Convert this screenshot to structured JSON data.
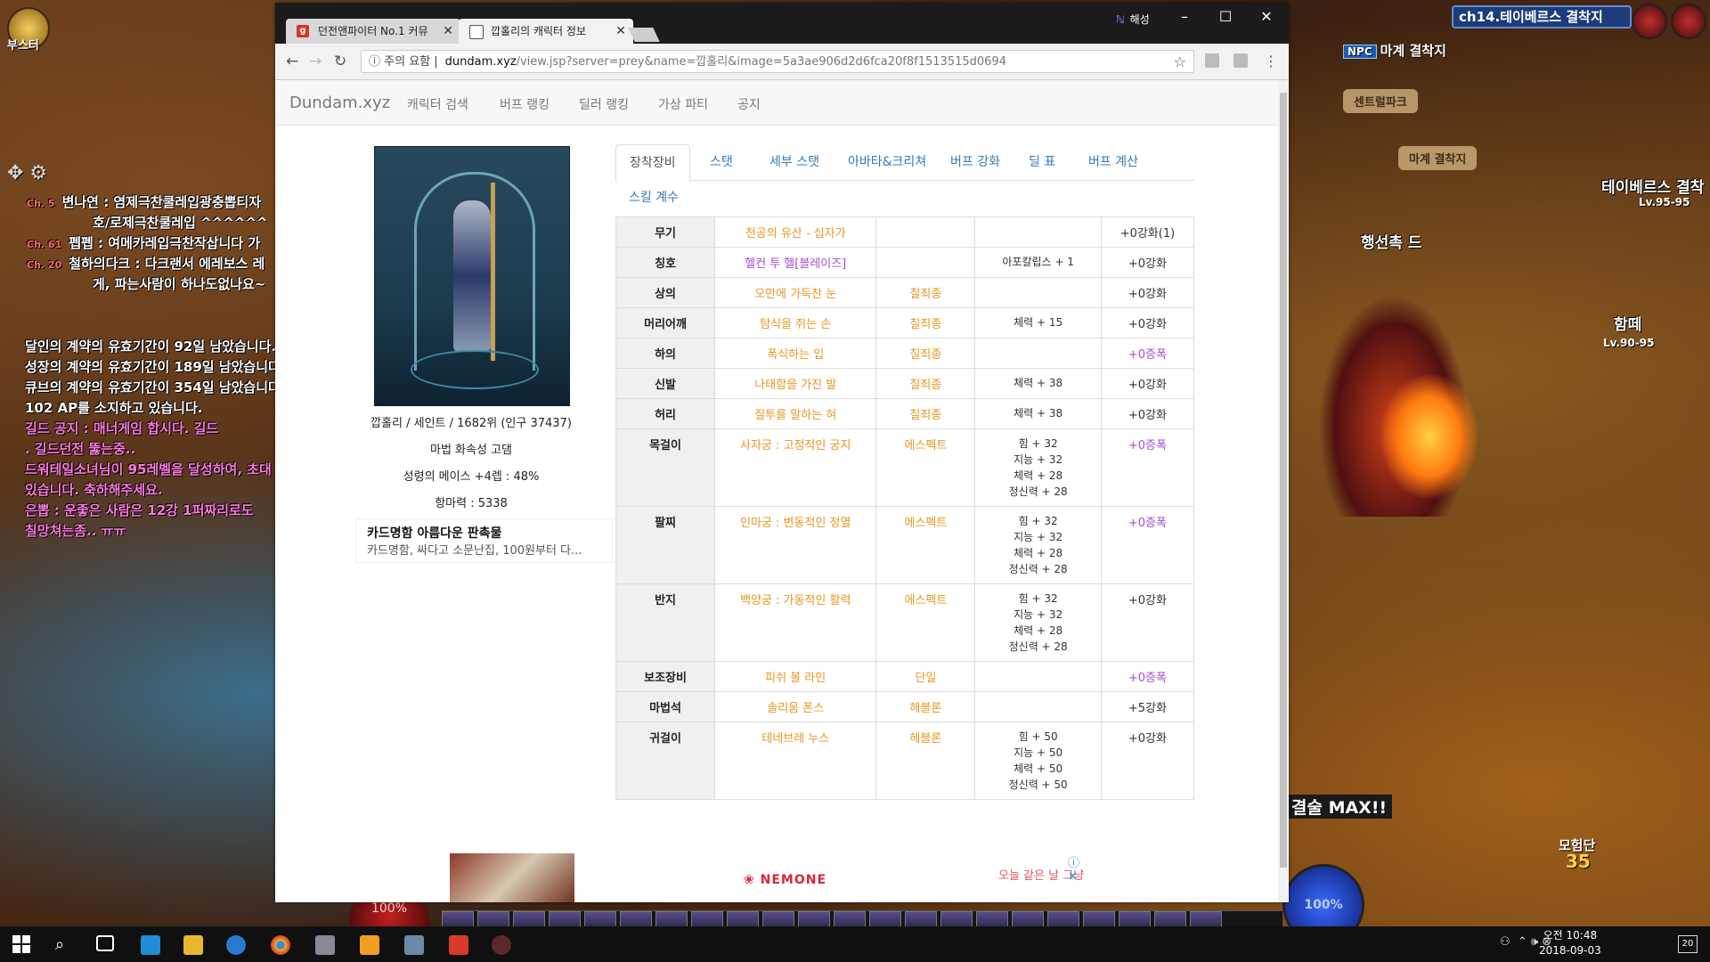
{
  "game": {
    "booster_label": "부스터",
    "chat": [
      {
        "channel": "Ch. 5",
        "text": "변나연 : 염제극찬쿨레입광충뽑티자",
        "color": "white"
      },
      {
        "channel": "",
        "text": "호/로제극찬쿨레입 ^^^^^^",
        "color": "white"
      },
      {
        "channel": "Ch. 61",
        "text": "펩펩 : 여메카레입극찬작삽니다 가",
        "color": "white"
      },
      {
        "channel": "Ch. 20",
        "text": "철하의다크 : 다크랜서 에레보스 레",
        "color": "white"
      },
      {
        "channel": "",
        "text": "게, 파는사람이 하나도없나요~",
        "color": "white"
      }
    ],
    "notices": [
      {
        "text": "달인의 계약의 유효기간이 92일 남았습니다.",
        "color": "white"
      },
      {
        "text": "성장의 계약의 유효기간이 189일 남았습니다.",
        "color": "white"
      },
      {
        "text": "큐브의 계약의 유효기간이 354일 남았습니다.",
        "color": "white"
      },
      {
        "text": "102 AP를 소지하고 있습니다.",
        "color": "white"
      },
      {
        "text": "길드 공지 : 매너게임 합시다. 길드",
        "color": "pink"
      },
      {
        "text": ". 길드던전 뚫는중..",
        "color": "pink"
      },
      {
        "text": "드워테일소녀님이 95레벨을 달성하여, 초대",
        "color": "pink"
      },
      {
        "text": "있습니다. 축하해주세요.",
        "color": "pink"
      },
      {
        "text": "은뽑 : 운좋은 사람은 12강 1퍼짜리로도",
        "color": "pink"
      },
      {
        "text": "칠망쳐는좀.. ㅠㅠ",
        "color": "pink"
      }
    ],
    "channel_label": "ch14.테이베르스 결착지",
    "npc_badge": "NPC",
    "area_title": "마계 결착지",
    "map_signs": [
      "센트럴파크",
      "마계 결착지"
    ],
    "map_labels": [
      {
        "name": "행선촉 드",
        "lv": ""
      },
      {
        "name": "테이베르스 결착",
        "lv": "Lv.95-95"
      },
      {
        "name": "함떼",
        "lv": "Lv.90-95"
      }
    ],
    "max_label": "결술 MAX!!",
    "party_label": "모험단",
    "party_num": "35",
    "hp_text": "100%",
    "mp_text": "100%"
  },
  "browser": {
    "tabs": [
      {
        "label": "던전앤파이터 No.1 커뮤",
        "favicon": "g",
        "favicon_color": "#d9332a"
      },
      {
        "label": "깝홀리의 캐릭터 정보",
        "favicon": "",
        "favicon_color": "#ffffff"
      }
    ],
    "profile": "해성",
    "security_label": "주의 요함",
    "url_host": "dundam.xyz",
    "url_path": "/view.jsp?server=prey&name=깝홀리&image=5a3ae906d2d6fca20f8f1513515d0694"
  },
  "site": {
    "brand": "Dundam.xyz",
    "nav": [
      "캐릭터 검색",
      "버프 랭킹",
      "딜러 랭킹",
      "가상 파티",
      "공지"
    ],
    "character": {
      "summary": "깝홀리 / 세인트 / 1682위 (인구 37437)",
      "element": "마법 화속성 고댐",
      "weapon_stat": "성령의 메이스 +4렙 : 48%",
      "magic_power": "항마력 : 5338"
    },
    "ad_card": {
      "title": "카드명함 아름다운 판촉물",
      "subtitle": "카드명함, 싸다고 소문난집, 100원부터 다..."
    },
    "tabs": [
      "장착장비",
      "스탯",
      "세부 스탯",
      "아바타&크리쳐",
      "버프 강화",
      "딜 표",
      "버프 계산",
      "스킬 계수"
    ],
    "equipment": [
      {
        "slot": "무기",
        "item": "천공의 유산 - 십자가",
        "item_color": "orange",
        "kind": "",
        "stats": [],
        "enhance": "+0강화(1)",
        "enhance_color": "dark"
      },
      {
        "slot": "칭호",
        "item": "헬컨 투 헬[블레이즈]",
        "item_color": "purple",
        "kind": "",
        "stats": [
          "아포칼립스 + 1"
        ],
        "enhance": "+0강화",
        "enhance_color": "dark"
      },
      {
        "slot": "상의",
        "item": "오만에 가득찬 눈",
        "item_color": "orange",
        "kind": "칠죄종",
        "stats": [],
        "enhance": "+0강화",
        "enhance_color": "dark"
      },
      {
        "slot": "머리어깨",
        "item": "탐식을 쥐는 손",
        "item_color": "orange",
        "kind": "칠죄종",
        "stats": [
          "체력 + 15"
        ],
        "enhance": "+0강화",
        "enhance_color": "dark"
      },
      {
        "slot": "하의",
        "item": "폭식하는 입",
        "item_color": "orange",
        "kind": "칠죄종",
        "stats": [],
        "enhance": "+0증폭",
        "enhance_color": "purple"
      },
      {
        "slot": "신발",
        "item": "나태함을 가진 발",
        "item_color": "orange",
        "kind": "칠죄종",
        "stats": [
          "체력 + 38"
        ],
        "enhance": "+0강화",
        "enhance_color": "dark"
      },
      {
        "slot": "허리",
        "item": "질투를 말하는 혀",
        "item_color": "orange",
        "kind": "칠죄종",
        "stats": [
          "체력 + 38"
        ],
        "enhance": "+0강화",
        "enhance_color": "dark"
      },
      {
        "slot": "목걸이",
        "item": "사자궁 : 고정적인 궁지",
        "item_color": "orange",
        "kind": "에스펙트",
        "stats": [
          "힘 + 32",
          "지능 + 32",
          "체력 + 28",
          "정신력 + 28"
        ],
        "enhance": "+0증폭",
        "enhance_color": "purple"
      },
      {
        "slot": "팔찌",
        "item": "인마궁 : 변동적인 정열",
        "item_color": "orange",
        "kind": "에스펙트",
        "stats": [
          "힘 + 32",
          "지능 + 32",
          "체력 + 28",
          "정신력 + 28"
        ],
        "enhance": "+0증폭",
        "enhance_color": "purple"
      },
      {
        "slot": "반지",
        "item": "백양궁 : 가동적인 활력",
        "item_color": "orange",
        "kind": "에스펙트",
        "stats": [
          "힘 + 32",
          "지능 + 32",
          "체력 + 28",
          "정신력 + 28"
        ],
        "enhance": "+0강화",
        "enhance_color": "dark"
      },
      {
        "slot": "보조장비",
        "item": "피쉬 볼 라인",
        "item_color": "orange",
        "kind": "단일",
        "stats": [],
        "enhance": "+0증폭",
        "enhance_color": "purple"
      },
      {
        "slot": "마법석",
        "item": "솔리움 폰스",
        "item_color": "orange",
        "kind": "헤블론",
        "stats": [],
        "enhance": "+5강화",
        "enhance_color": "dark"
      },
      {
        "slot": "귀걸이",
        "item": "테네브레 누스",
        "item_color": "orange",
        "kind": "헤블론",
        "stats": [
          "힘 + 50",
          "지능 + 50",
          "체력 + 50",
          "정신력 + 50"
        ],
        "enhance": "+0강화",
        "enhance_color": "dark"
      }
    ],
    "bottom_ad": {
      "logo": "NEMONE",
      "hint": "오늘 같은 날 그냥",
      "close": "ⓘ ✕"
    }
  },
  "taskbar": {
    "time": "오전 10:48",
    "date": "2018-09-03",
    "notifications": "20"
  },
  "colors": {
    "orange": "#e8961e",
    "purple": "#a44cd0",
    "dark": "#333333",
    "link": "#337ab7"
  }
}
